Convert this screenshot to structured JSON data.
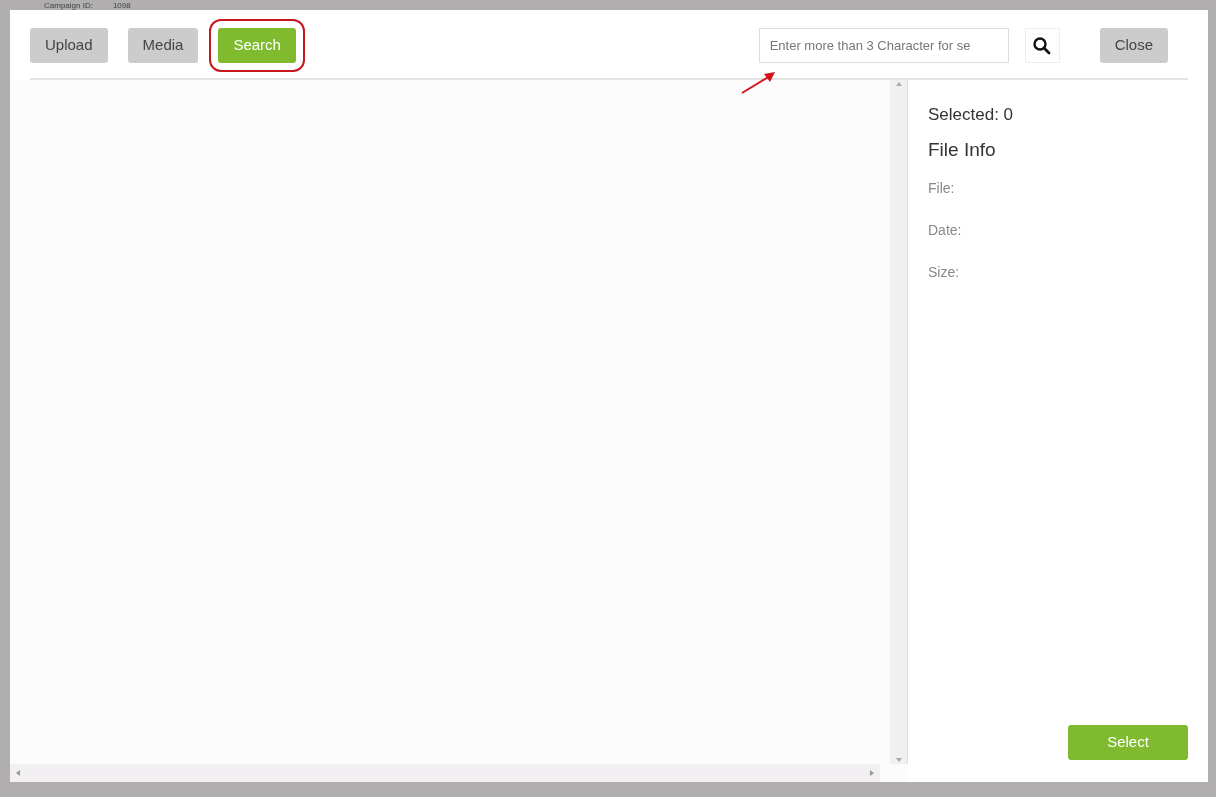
{
  "background_page": {
    "fields": [
      {
        "label": "Campaign ID:",
        "value": "1098"
      }
    ]
  },
  "toolbar": {
    "buttons": [
      {
        "label": "Upload",
        "kind": "secondary",
        "highlighted": false
      },
      {
        "label": "Media",
        "kind": "secondary",
        "highlighted": false
      },
      {
        "label": "Search",
        "kind": "primary",
        "highlighted": true
      }
    ],
    "search": {
      "placeholder": "Enter more than 3 Character for se"
    },
    "close": {
      "label": "Close"
    }
  },
  "file_info": {
    "selected": "Selected: 0",
    "title": "File Info",
    "fields": [
      "File:",
      "Date:",
      "Size:"
    ]
  },
  "select_button": {
    "label": "Select"
  }
}
